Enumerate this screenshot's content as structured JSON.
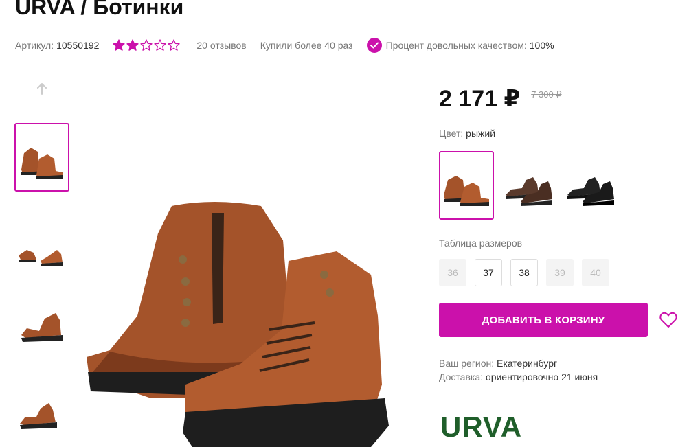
{
  "product": {
    "title": "URVA / Ботинки",
    "sku_label": "Артикул:",
    "sku_value": "10550192",
    "rating": 2,
    "rating_max": 5,
    "reviews": "20 отзывов",
    "bought": "Купили более 40 раз",
    "quality_label": "Процент довольных качеством:",
    "quality_value": "100%"
  },
  "pricing": {
    "price": "2 171 ₽",
    "old_price": "7 300 ₽"
  },
  "color": {
    "label": "Цвет:",
    "value": "рыжий",
    "options": [
      "brown",
      "dark-brown",
      "black"
    ],
    "selected": 0
  },
  "sizes": {
    "table_link": "Таблица размеров",
    "items": [
      {
        "label": "36",
        "available": false
      },
      {
        "label": "37",
        "available": true
      },
      {
        "label": "38",
        "available": true
      },
      {
        "label": "39",
        "available": false
      },
      {
        "label": "40",
        "available": false
      }
    ]
  },
  "cart": {
    "add_label": "ДОБАВИТЬ В КОРЗИНУ"
  },
  "delivery": {
    "region_label": "Ваш регион:",
    "region_value": "Екатеринбург",
    "delivery_label": "Доставка:",
    "delivery_value": "ориентировочно 21 июня"
  },
  "brand": {
    "logo": "URVA"
  },
  "colors": {
    "accent": "#cb11ab",
    "brand_green": "#1f5e2a",
    "boot_brown": "#a4532a",
    "boot_dark": "#5a3a2c",
    "boot_black": "#222222"
  },
  "icons": [
    "arrow-up-icon",
    "star-icon",
    "check-icon",
    "heart-icon"
  ]
}
